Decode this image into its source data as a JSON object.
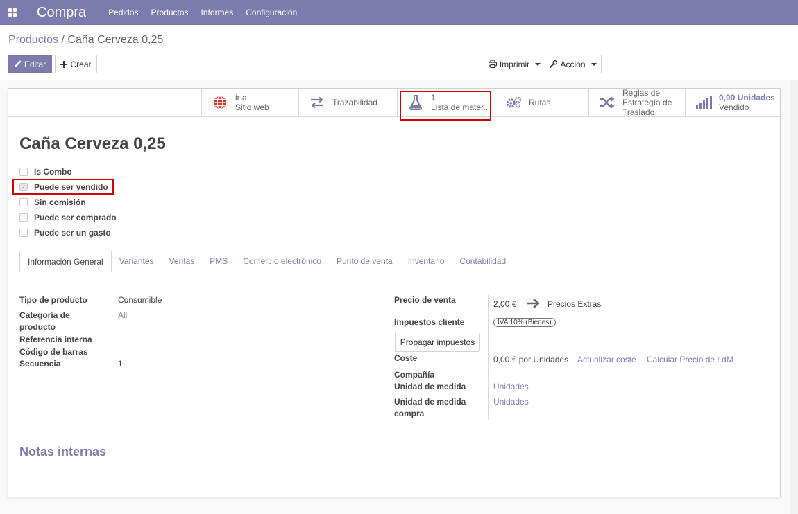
{
  "navbar": {
    "app_name": "Compra",
    "menu": [
      "Pedidos",
      "Productos",
      "Informes",
      "Configuración"
    ]
  },
  "breadcrumb": {
    "parent": "Productos",
    "separator": "/",
    "current": "Caña Cerveza 0,25"
  },
  "toolbar": {
    "edit": "Editar",
    "create": "Crear",
    "print": "Imprimir",
    "action": "Acción"
  },
  "smart_buttons": {
    "website": {
      "line1": "ir a",
      "line2": "Sitio web"
    },
    "traceability": {
      "label": "Trazabilidad"
    },
    "bom": {
      "count": "1",
      "label": "Lista de mater..."
    },
    "routes": {
      "label": "Rutas"
    },
    "putaway": {
      "line1": "Reglas de",
      "line2": "Estrategía de",
      "line3": "Traslado"
    },
    "sold": {
      "value": "0,00 Unidades",
      "label": "Vendido"
    }
  },
  "product": {
    "name": "Caña Cerveza 0,25"
  },
  "checkboxes": [
    {
      "label": "Is Combo",
      "checked": false
    },
    {
      "label": "Puede ser vendido",
      "checked": true
    },
    {
      "label": "Sin comisión",
      "checked": false
    },
    {
      "label": "Puede ser comprado",
      "checked": false
    },
    {
      "label": "Puede ser un gasto",
      "checked": false
    }
  ],
  "tabs": [
    "Información General",
    "Variantes",
    "Ventas",
    "PMS",
    "Comercio electrónico",
    "Punto de venta",
    "Inventario",
    "Contabilidad"
  ],
  "left_fields": {
    "product_type": {
      "label": "Tipo de producto",
      "value": "Consumible"
    },
    "category": {
      "label_line1": "Categoría de",
      "label_line2": "producto",
      "value": "All"
    },
    "internal_ref": {
      "label": "Referencia interna"
    },
    "barcode": {
      "label": "Código de barras"
    },
    "sequence": {
      "label": "Secuencia",
      "value": "1"
    }
  },
  "right_fields": {
    "sale_price": {
      "label": "Precio de venta",
      "value": "2,00 €",
      "extra": "Precios Extras"
    },
    "customer_taxes": {
      "label": "Impuestos cliente",
      "tag": "IVA 10% (Bienes)"
    },
    "propagate": {
      "label": "Propagar impuestos"
    },
    "cost": {
      "label": "Coste",
      "value": "0,00 € por Unidades",
      "update": "Actualizar coste",
      "compute": "Calcular Precio de LdM"
    },
    "company": {
      "label": "Compañía"
    },
    "uom": {
      "label": "Unidad de medida",
      "value": "Unidades"
    },
    "uom_po": {
      "label_line1": "Unidad de medida",
      "label_line2": "compra",
      "value": "Unidades"
    }
  },
  "notes": {
    "title": "Notas internas"
  },
  "colors": {
    "brand": "#7c7bad",
    "highlight": "#d10000"
  }
}
